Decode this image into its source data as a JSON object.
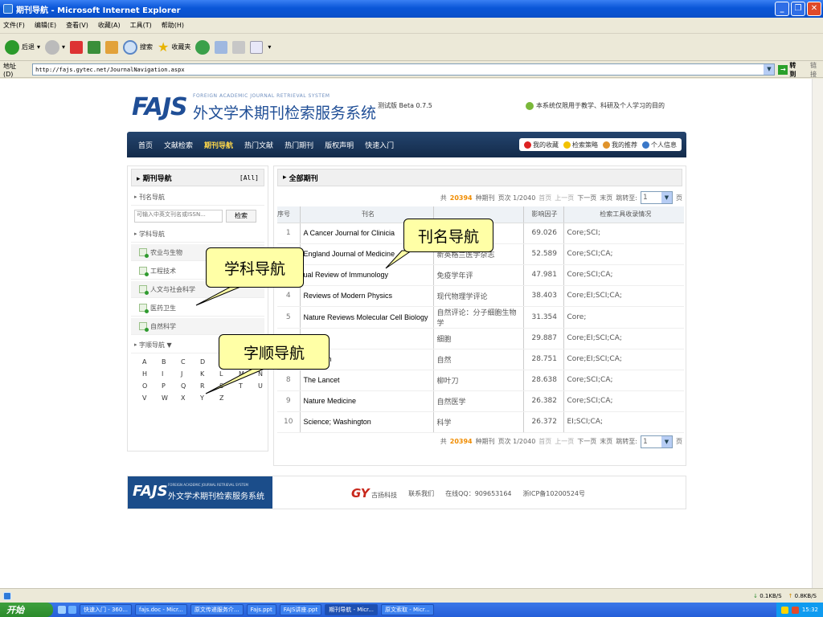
{
  "window": {
    "title": "期刊导航 - Microsoft Internet Explorer"
  },
  "menu": [
    "文件(F)",
    "编辑(E)",
    "查看(V)",
    "收藏(A)",
    "工具(T)",
    "帮助(H)"
  ],
  "toolbar": {
    "back": "后退",
    "search": "搜索",
    "favorites": "收藏夹"
  },
  "address": {
    "label": "地址(D)",
    "url": "http://fajs.gytec.net/JournalNavigation.aspx",
    "go": "转到",
    "links": "链接"
  },
  "header": {
    "logo": "FAJS",
    "logo_en": "FOREIGN ACADEMIC JOURNAL RETRIEVAL SYSTEM",
    "logo_cn": "外文学术期刊检索服务系统",
    "beta": "测试版 Beta 0.7.5",
    "notice": "本系统仅限用于教学、科研及个人学习的目的"
  },
  "nav": {
    "items": [
      "首页",
      "文献检索",
      "期刊导航",
      "热门文献",
      "热门期刊",
      "版权声明",
      "快速入门"
    ],
    "right": [
      "我的收藏",
      "检索策略",
      "我的推荐",
      "个人信息"
    ],
    "colors": {
      "active": "#ffd84a",
      "bar": "#1d3a60"
    }
  },
  "sidebar": {
    "head": "期刊导航",
    "all": "[All]",
    "title_nav": "刊名导航",
    "search_placeholder": "可输入中英文刊名或ISSN...",
    "search_btn": "检索",
    "subject_nav": "学科导航",
    "subjects": [
      "农业与生物",
      "工程技术",
      "人文与社会科学",
      "医药卫生",
      "自然科学"
    ],
    "alpha_nav": "字顺导航 ▼",
    "letters": [
      "A",
      "B",
      "C",
      "D",
      "E",
      "F",
      "G",
      "H",
      "I",
      "J",
      "K",
      "L",
      "M",
      "N",
      "O",
      "P",
      "Q",
      "R",
      "S",
      "T",
      "U",
      "V",
      "W",
      "X",
      "Y",
      "Z"
    ]
  },
  "main": {
    "head": "全部期刊",
    "pager": {
      "prefix": "共",
      "total": "20394",
      "unit": "种期刊",
      "page": "页次 1/2040",
      "first": "首页",
      "prev": "上一页",
      "next": "下一页",
      "last": "末页",
      "jump": "跳转至:",
      "jump_val": "1",
      "jump_unit": "页"
    },
    "columns": [
      "序号",
      "刊名",
      "",
      "影响因子",
      "检索工具收录情况"
    ],
    "rows": [
      {
        "no": "1",
        "name": "A Cancer Journal for Clinicia",
        "cn": "",
        "if": "69.026",
        "db": "Core;SCI;"
      },
      {
        "no": "2",
        "name": "England Journal of Medicine",
        "cn": "新英格兰医学杂志",
        "if": "52.589",
        "db": "Core;SCI;CA;"
      },
      {
        "no": "3",
        "name": "ual Review of Immunology",
        "cn": "免疫学年评",
        "if": "47.981",
        "db": "Core;SCI;CA;"
      },
      {
        "no": "4",
        "name": "Reviews of Modern Physics",
        "cn": "现代物理学评论",
        "if": "38.403",
        "db": "Core;EI;SCI;CA;"
      },
      {
        "no": "5",
        "name": "Nature Reviews Molecular Cell Biology",
        "cn": "自然评论：分子细胞生物学",
        "if": "31.354",
        "db": "Core;"
      },
      {
        "no": "",
        "name": "",
        "cn": "细胞",
        "if": "29.887",
        "db": "Core;EI;SCI;CA;"
      },
      {
        "no": "",
        "name": "; London",
        "cn": "自然",
        "if": "28.751",
        "db": "Core;EI;SCI;CA;"
      },
      {
        "no": "8",
        "name": "The Lancet",
        "cn": "柳叶刀",
        "if": "28.638",
        "db": "Core;SCI;CA;"
      },
      {
        "no": "9",
        "name": "Nature Medicine",
        "cn": "自然医学",
        "if": "26.382",
        "db": "Core;SCI;CA;"
      },
      {
        "no": "10",
        "name": "Science; Washington",
        "cn": "科学",
        "if": "26.372",
        "db": "EI;SCI;CA;"
      }
    ]
  },
  "footer": {
    "logo": "FAJS",
    "logo_en": "FOREIGN ACADEMIC JOURNAL RETRIEVAL SYSTEM",
    "logo_cn": "外文学术期刊检索服务系统",
    "gy": "GY",
    "company": "古扬科技",
    "contact": "联系我们",
    "qq": "在线QQ：909653164",
    "icp": "浙ICP备10200524号"
  },
  "callouts": {
    "title_nav": "刊名导航",
    "subject_nav": "学科导航",
    "alpha_nav": "字顺导航"
  },
  "status": {
    "down": "0.1KB/S",
    "up": "0.8KB/S"
  },
  "taskbar": {
    "start": "开始",
    "tasks": [
      "快速入门 - 360...",
      "fajs.doc - Micr...",
      "原文传递服务介...",
      "Fajs.ppt",
      "FAJS讲座.ppt",
      "期刊导航 - Micr...",
      "原文索取 - Micr..."
    ],
    "clock": "15:32"
  }
}
